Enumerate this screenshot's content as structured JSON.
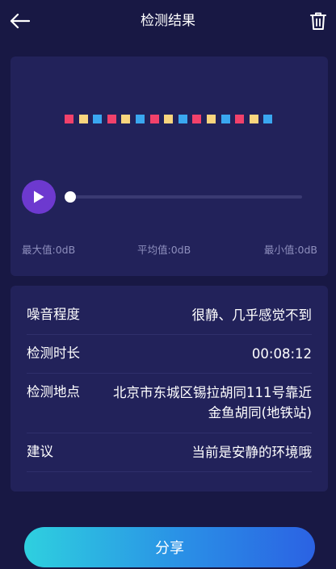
{
  "header": {
    "title": "检测结果",
    "back_icon": "arrow-left-icon",
    "delete_icon": "trash-icon"
  },
  "player": {
    "bar_colors": [
      "#f2416b",
      "#f9d57e",
      "#3aa7f0",
      "#f2416b",
      "#f9d57e",
      "#3aa7f0",
      "#f2416b",
      "#f9d57e",
      "#3aa7f0",
      "#f2416b",
      "#f9d57e",
      "#3aa7f0",
      "#f2416b",
      "#f9d57e",
      "#3aa7f0"
    ],
    "progress": 0,
    "max_label": "最大值:",
    "max_value": "0dB",
    "avg_label": "平均值:",
    "avg_value": "0dB",
    "min_label": "最小值:",
    "min_value": "0dB"
  },
  "details": {
    "noise_level_label": "噪音程度",
    "noise_level_value": "很静、几乎感觉不到",
    "duration_label": "检测时长",
    "duration_value": "00:08:12",
    "location_label": "检测地点",
    "location_line1": "北京市东城区锡拉胡同111号靠近",
    "location_line2": "金鱼胡同(地铁站)",
    "advice_label": "建议",
    "advice_value": "当前是安静的环境哦"
  },
  "share": {
    "label": "分享"
  },
  "colors": {
    "background": "#181844",
    "card": "#22225a",
    "play_button": "#6d39cf",
    "stat_text": "#8e8fbd"
  }
}
